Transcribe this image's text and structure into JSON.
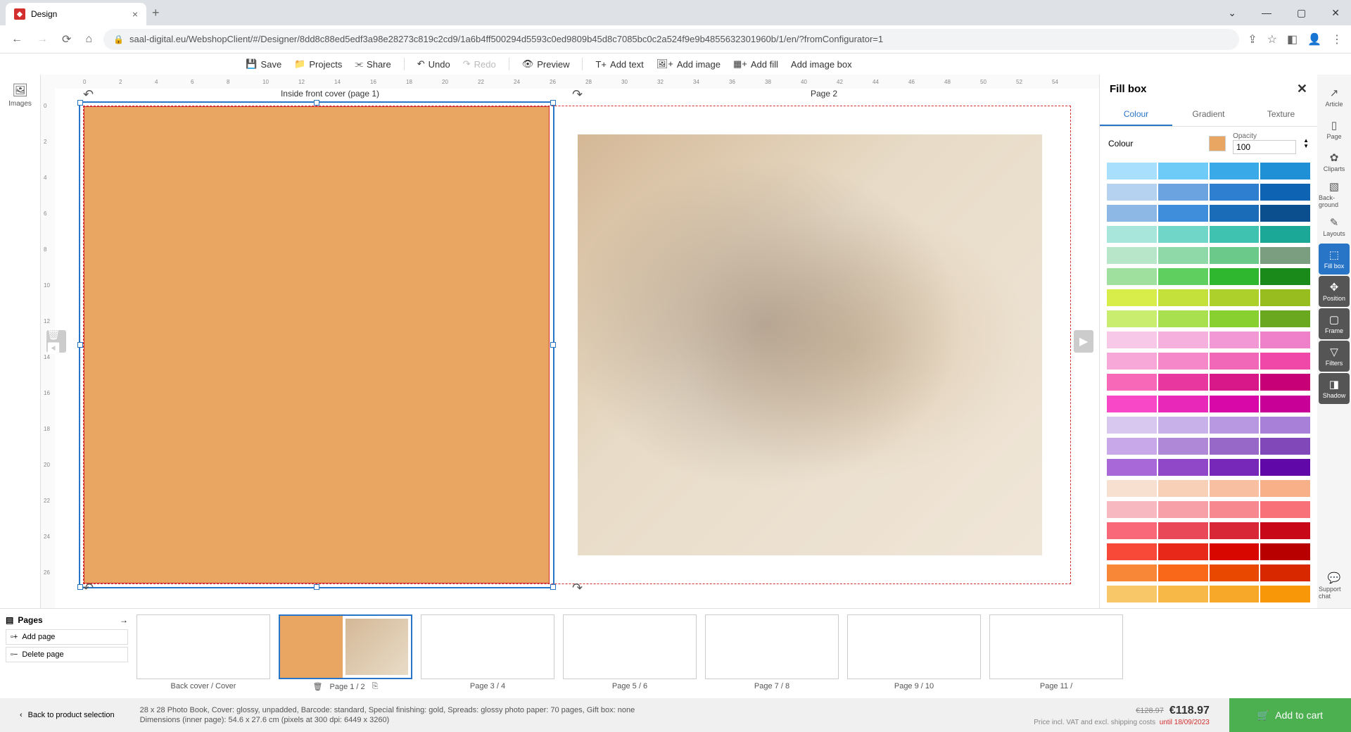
{
  "browser": {
    "tab_title": "Design",
    "url": "saal-digital.eu/WebshopClient/#/Designer/8dd8c88ed5edf3a98e28273c819c2cd9/1a6b4ff500294d5593c0ed9809b45d8c7085bc0c2a524f9e9b4855632301960b/1/en/?fromConfigurator=1"
  },
  "toolbar": {
    "save": "Save",
    "projects": "Projects",
    "share": "Share",
    "undo": "Undo",
    "redo": "Redo",
    "preview": "Preview",
    "add_text": "Add text",
    "add_image": "Add image",
    "add_fill": "Add fill",
    "add_image_box": "Add image box"
  },
  "left_sidebar": {
    "images": "Images"
  },
  "right_sidebar": {
    "article": "Article",
    "page": "Page",
    "cliparts": "Cliparts",
    "background": "Back-ground",
    "layouts": "Layouts",
    "fillbox": "Fill box",
    "position": "Position",
    "frame": "Frame",
    "filters": "Filters",
    "shadow": "Shadow",
    "support": "Support chat"
  },
  "canvas": {
    "page_left_label": "Inside front cover (page 1)",
    "page_right_label": "Page 2",
    "fill_color": "#e8a662",
    "ruler_h": [
      "0",
      "2",
      "4",
      "6",
      "8",
      "10",
      "12",
      "14",
      "16",
      "18",
      "20",
      "22",
      "24",
      "26",
      "28",
      "30",
      "32",
      "34",
      "36",
      "38",
      "40",
      "42",
      "44",
      "46",
      "48",
      "50",
      "52",
      "54"
    ],
    "ruler_v": [
      "0",
      "2",
      "4",
      "6",
      "8",
      "10",
      "12",
      "14",
      "16",
      "18",
      "20",
      "22",
      "24",
      "26"
    ]
  },
  "panel": {
    "title": "Fill box",
    "tabs": {
      "colour": "Colour",
      "gradient": "Gradient",
      "texture": "Texture"
    },
    "colour_label": "Colour",
    "opacity_label": "Opacity",
    "opacity_value": "100",
    "swatches": [
      "#a8dffc",
      "#6ecaf7",
      "#3aa9e8",
      "#1f8fd6",
      "#b5d3f0",
      "#6ba3e0",
      "#2f7fd1",
      "#0e63b3",
      "#8db8e6",
      "#3f8edb",
      "#1a6bb8",
      "#0b4f8f",
      "#a8e6dc",
      "#6fd6c8",
      "#3fc2b0",
      "#1ca896",
      "#b8e6c8",
      "#8fd9a8",
      "#6bc98a",
      "#7a9e7f",
      "#9fe09f",
      "#5fcf5f",
      "#2fb82f",
      "#1a8a1a",
      "#d9ed4a",
      "#c4e03a",
      "#aed02a",
      "#98bd1f",
      "#c8ed6f",
      "#a8e04f",
      "#88d02f",
      "#6aa81f",
      "#f8c8e8",
      "#f5b0de",
      "#f298d4",
      "#ef80ca",
      "#f8a8d8",
      "#f588c8",
      "#f268b8",
      "#ef48a8",
      "#f868b8",
      "#e8389f",
      "#d81888",
      "#c80078",
      "#f848c8",
      "#e828b8",
      "#d808a8",
      "#c80098",
      "#d8c8f0",
      "#c8b0e8",
      "#b898e0",
      "#a880d8",
      "#c8a8e8",
      "#b088d8",
      "#9868c8",
      "#8048b8",
      "#a868d8",
      "#9048c8",
      "#7828b8",
      "#6008a8",
      "#f8e0d0",
      "#f8d0b8",
      "#f8c0a0",
      "#f8b088",
      "#f8b8c0",
      "#f8a0a8",
      "#f88890",
      "#f87078",
      "#f86878",
      "#e84858",
      "#d82838",
      "#c80818",
      "#f84838",
      "#e82818",
      "#d80800",
      "#b80000",
      "#f88838",
      "#f86818",
      "#e84800",
      "#d82800",
      "#f8c868",
      "#f8b848",
      "#f8a828",
      "#f89808"
    ]
  },
  "pages_strip": {
    "title": "Pages",
    "add": "Add page",
    "delete": "Delete page",
    "thumbs": [
      {
        "label": "Back cover / Cover"
      },
      {
        "label": "Page 1 / 2",
        "active": true,
        "left_fill": "#e8a662",
        "has_photo": true
      },
      {
        "label": "Page 3 / 4"
      },
      {
        "label": "Page 5 / 6"
      },
      {
        "label": "Page 7 / 8"
      },
      {
        "label": "Page 9 / 10"
      },
      {
        "label": "Page 11 /"
      }
    ]
  },
  "footer": {
    "back": "Back to product selection",
    "spec": "28 x 28 Photo Book, Cover: glossy, unpadded, Barcode: standard, Special finishing: gold, Spreads: glossy photo paper: 70 pages, Gift box: none",
    "dims": "Dimensions (inner page): 54.6 x 27.6 cm (pixels at 300 dpi: 6449 x 3260)",
    "old_price": "€128.97",
    "new_price": "€118.97",
    "price_note": "Price incl. VAT and excl. shipping costs",
    "valid_until": "until 18/09/2023",
    "cart": "Add to cart"
  }
}
